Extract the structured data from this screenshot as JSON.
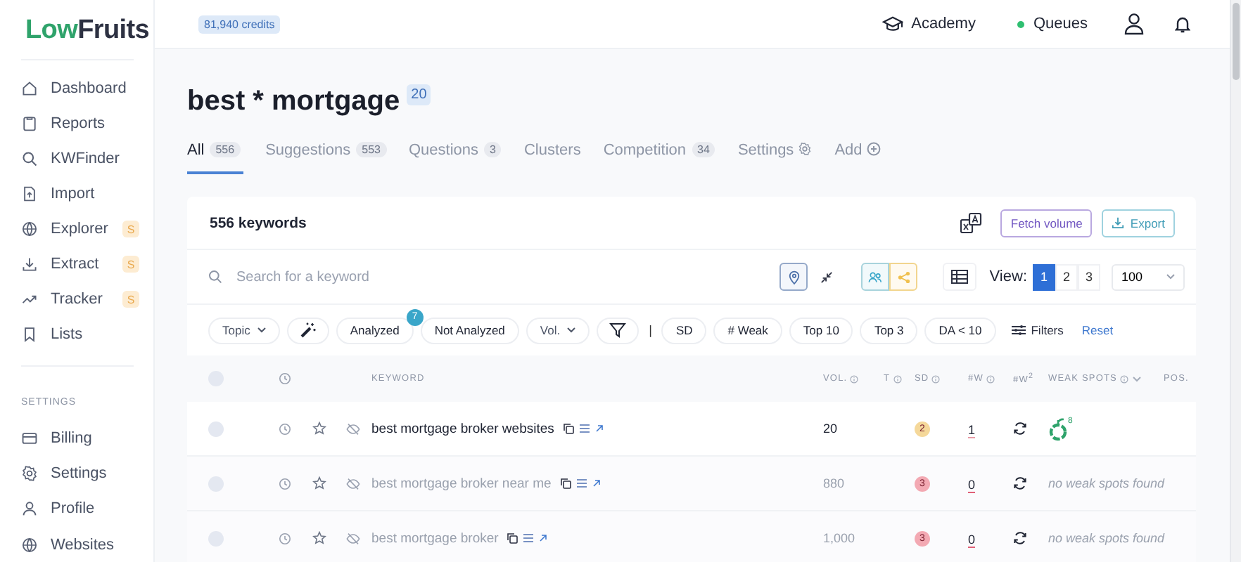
{
  "logo": {
    "accent": "Low",
    "rest": "Fruits"
  },
  "sidebar": {
    "items": [
      {
        "label": "Dashboard"
      },
      {
        "label": "Reports"
      },
      {
        "label": "KWFinder"
      },
      {
        "label": "Import"
      },
      {
        "label": "Explorer",
        "badge": "S"
      },
      {
        "label": "Extract",
        "badge": "S"
      },
      {
        "label": "Tracker",
        "badge": "S"
      },
      {
        "label": "Lists"
      }
    ],
    "section_label": "SETTINGS",
    "settings_items": [
      {
        "label": "Billing"
      },
      {
        "label": "Settings"
      },
      {
        "label": "Profile"
      },
      {
        "label": "Websites"
      }
    ]
  },
  "topbar": {
    "credits": "81,940 credits",
    "academy": "Academy",
    "queues": "Queues",
    "queues_online": true
  },
  "title": "best * mortgage",
  "title_badge": "20",
  "tabs": [
    {
      "kind": "count",
      "label": "All",
      "count": "556",
      "selected": true
    },
    {
      "kind": "count",
      "label": "Suggestions",
      "count": "553",
      "selected": false
    },
    {
      "kind": "count",
      "label": "Questions",
      "count": "3",
      "selected": false
    },
    {
      "kind": "plain",
      "label": "Clusters",
      "selected": false
    },
    {
      "kind": "count",
      "label": "Competition",
      "count": "34",
      "selected": false
    },
    {
      "kind": "settings",
      "label": "Settings",
      "selected": false
    },
    {
      "kind": "add",
      "label": "Add",
      "selected": false
    }
  ],
  "card": {
    "heading": "556 keywords",
    "fetch_button": "Fetch volume",
    "export_button": "Export",
    "search": {
      "placeholder": "Search for a keyword"
    },
    "view_label": "View:",
    "views": [
      {
        "label": "1",
        "selected": true
      },
      {
        "label": "2",
        "selected": false
      },
      {
        "label": "3",
        "selected": false
      }
    ],
    "page_size": "100",
    "filters": [
      {
        "kind": "select",
        "label": "Topic"
      },
      {
        "kind": "wand"
      },
      {
        "kind": "chip",
        "label": "Analyzed",
        "badge": "7"
      },
      {
        "kind": "chip",
        "label": "Not Analyzed"
      },
      {
        "kind": "select",
        "label": "Vol."
      },
      {
        "kind": "funnel"
      },
      {
        "kind": "divider",
        "label": "|"
      },
      {
        "kind": "chip",
        "label": "SD"
      },
      {
        "kind": "chip",
        "label": "# Weak"
      },
      {
        "kind": "chip",
        "label": "Top 10"
      },
      {
        "kind": "chip",
        "label": "Top 3"
      },
      {
        "kind": "chip",
        "label": "DA  < 10"
      },
      {
        "kind": "filters",
        "label": "Filters"
      },
      {
        "kind": "link",
        "label": "Reset"
      }
    ]
  },
  "table": {
    "columns": [
      {
        "kind": "plain",
        "label": "KEYWORD"
      },
      {
        "kind": "info",
        "label": "VOL."
      },
      {
        "kind": "info",
        "label": "T"
      },
      {
        "kind": "info",
        "label": "SD"
      },
      {
        "kind": "info",
        "label": "#W"
      },
      {
        "kind": "plain",
        "label": "#W$^{2}$"
      },
      {
        "kind": "menu",
        "label": "WEAK SPOTS"
      },
      {
        "kind": "plain",
        "label": "POS."
      }
    ],
    "header_checked": false,
    "rows": [
      {
        "checked": false,
        "dimmed": false,
        "keyword": "best mortgage broker websites",
        "volume": "20",
        "sd": "2",
        "color": "#f5d89a",
        "weak": "1",
        "weak_spots": {
          "kind": "fruit",
          "count": "8"
        }
      },
      {
        "checked": false,
        "dimmed": true,
        "keyword": "best mortgage broker near me",
        "volume": "880",
        "sd": "3",
        "color": "#f3a9b3",
        "weak": "0",
        "weak_spots": {
          "kind": "text",
          "text": "no weak spots found"
        }
      },
      {
        "checked": false,
        "dimmed": true,
        "keyword": "best mortgage broker",
        "volume": "1,000",
        "sd": "3",
        "color": "#f3a9b3",
        "weak": "0",
        "weak_spots": {
          "kind": "text",
          "text": "no weak spots found"
        }
      }
    ]
  }
}
